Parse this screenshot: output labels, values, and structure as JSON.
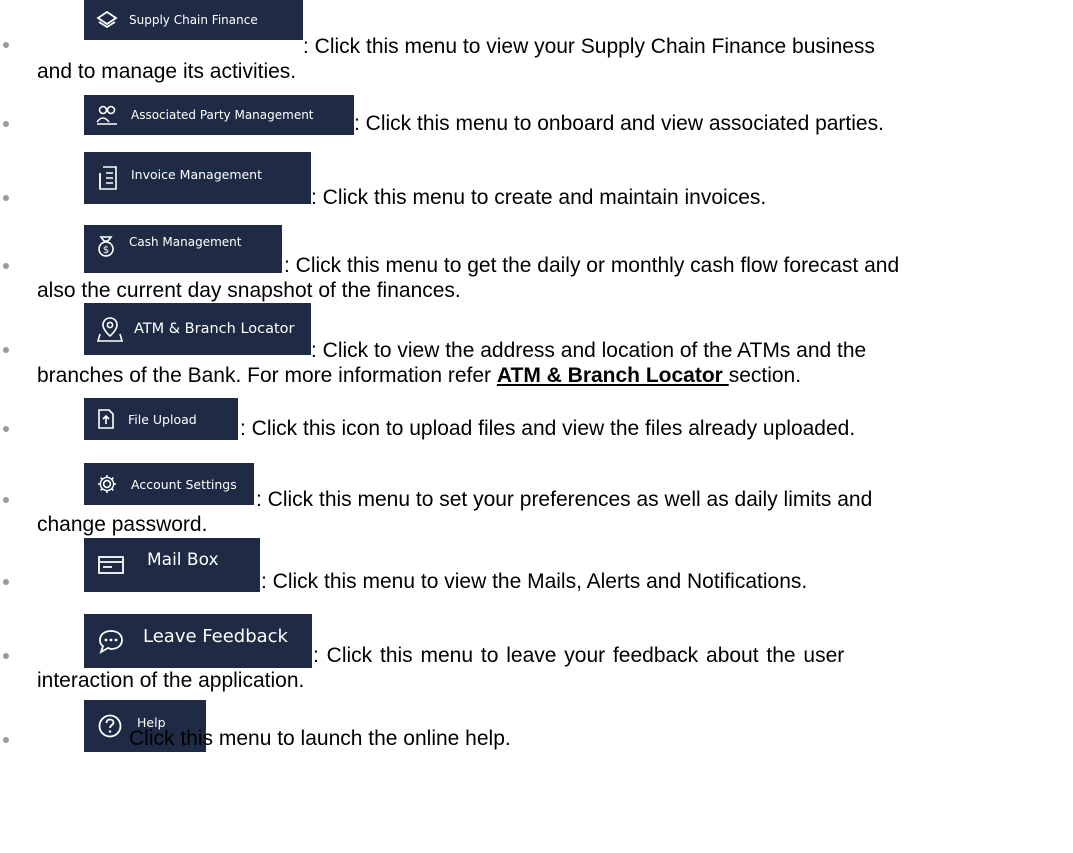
{
  "items": [
    {
      "label": "Supply Chain Finance",
      "icon": "layers-icon",
      "line1": ":  Click this menu to view your Supply Chain Finance business",
      "line2": "and to manage its activities."
    },
    {
      "label": "Associated Party Management",
      "icon": "people-icon",
      "line1": ": Click this menu to onboard and view associated parties."
    },
    {
      "label": "Invoice Management",
      "icon": "invoice-icon",
      "line1": ": Click this menu to create and maintain invoices."
    },
    {
      "label": "Cash Management",
      "icon": "money-bag-icon",
      "line1": ": Click this menu to get the daily or monthly cash flow forecast and",
      "line2": "also the current day snapshot of the finances."
    },
    {
      "label": "ATM & Branch Locator",
      "icon": "map-pin-icon",
      "line1": ": Click to view the address and location of the ATMs and the",
      "line2_pre": "branches of the Bank. For more information refer ",
      "line2_link": "ATM & Branch Locator ",
      "line2_post": "section."
    },
    {
      "label": "File Upload",
      "icon": "file-upload-icon",
      "line1": ": Click this icon to upload files and view the files already uploaded."
    },
    {
      "label": "Account Settings",
      "icon": "gear-icon",
      "line1": ": Click this menu to set your preferences as well as daily limits and",
      "line2": "change password."
    },
    {
      "label": "Mail Box",
      "icon": "mail-box-icon",
      "line1": ": Click this menu to view the Mails, Alerts and Notifications."
    },
    {
      "label": "Leave Feedback",
      "icon": "chat-bubble-icon",
      "line1": ":  Click  this  menu  to  leave  your  feedback  about  the  user",
      "line2": "interaction of the application."
    },
    {
      "label": "Help",
      "icon": "help-circle-icon",
      "line1": "Click this menu to launch the online help."
    }
  ],
  "colors": {
    "button_bg": "#1f2a44",
    "button_text": "#ffffff",
    "bullet": "#9b9b9b"
  }
}
